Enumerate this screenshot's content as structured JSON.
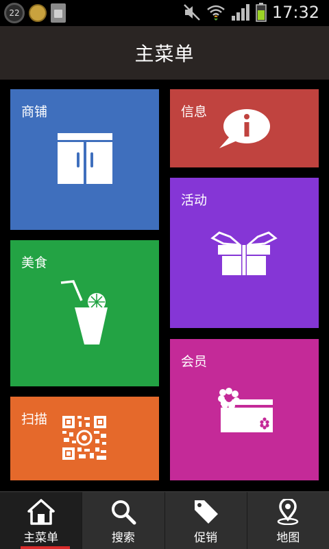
{
  "status_bar": {
    "notification_count": "22",
    "time": "17:32"
  },
  "header": {
    "title": "主菜单"
  },
  "tiles": {
    "shop": {
      "label": "商铺",
      "color": "#3f6fbd",
      "icon": "cabinet-icon"
    },
    "info": {
      "label": "信息",
      "color": "#c0433f",
      "icon": "info-bubble-icon"
    },
    "event": {
      "label": "活动",
      "color": "#8536d6",
      "icon": "gift-icon"
    },
    "food": {
      "label": "美食",
      "color": "#23a344",
      "icon": "drink-icon"
    },
    "member": {
      "label": "会员",
      "color": "#c42a98",
      "icon": "member-card-icon"
    },
    "scan": {
      "label": "扫描",
      "color": "#e5692b",
      "icon": "qr-code-icon"
    }
  },
  "bottom_nav": {
    "items": [
      {
        "label": "主菜单",
        "icon": "home-icon",
        "active": true
      },
      {
        "label": "搜索",
        "icon": "search-icon",
        "active": false
      },
      {
        "label": "促销",
        "icon": "tag-icon",
        "active": false
      },
      {
        "label": "地图",
        "icon": "map-pin-icon",
        "active": false
      }
    ],
    "active_color": "#d92b2b"
  }
}
